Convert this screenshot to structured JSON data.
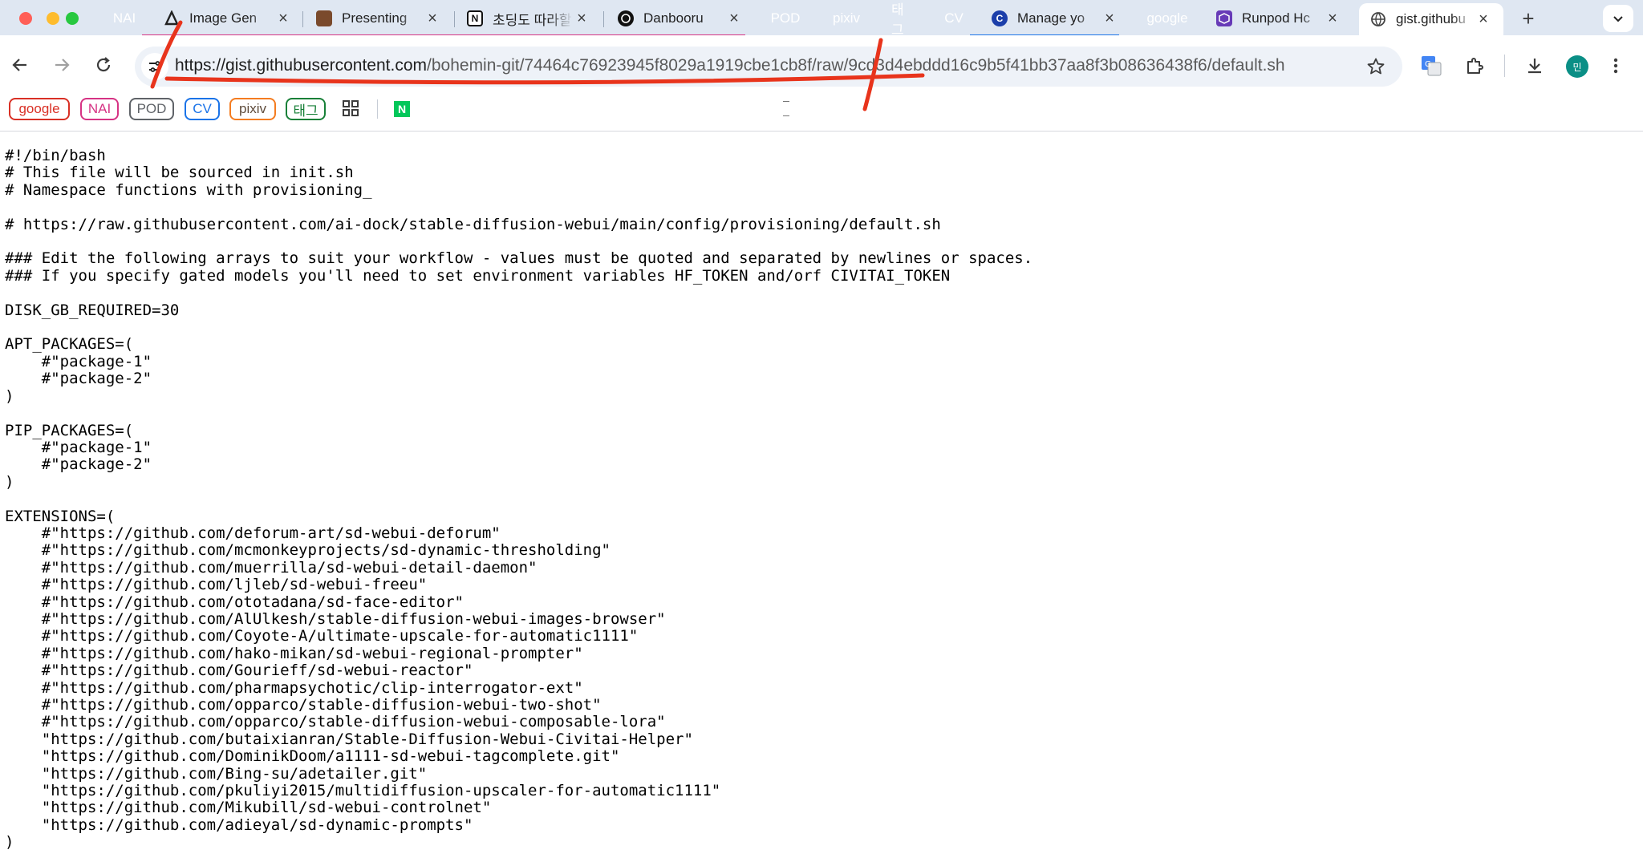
{
  "window": {
    "controls": [
      "close",
      "minimize",
      "zoom"
    ]
  },
  "tabs": [
    {
      "kind": "chip",
      "label": "NAI",
      "color": "#d63384"
    },
    {
      "kind": "tab",
      "title": "Image Gen",
      "icon": "novelai-icon"
    },
    {
      "kind": "tab",
      "title": "Presenting",
      "icon": "book-icon"
    },
    {
      "kind": "tab",
      "title": "초딩도 따라할",
      "icon": "notion-icon"
    },
    {
      "kind": "tab",
      "title": "Danbooru",
      "icon": "openai-icon"
    },
    {
      "kind": "chip",
      "label": "POD",
      "color": "#5f6368"
    },
    {
      "kind": "chip",
      "label": "pixiv",
      "color": "#f47c20"
    },
    {
      "kind": "chip",
      "label": "태그",
      "color": "#188038"
    },
    {
      "kind": "chip",
      "label": "CV",
      "color": "#1a73e8"
    },
    {
      "kind": "tab",
      "title": "Manage yo",
      "icon": "civitai-icon"
    },
    {
      "kind": "chip",
      "label": "google",
      "color": "#d93025"
    },
    {
      "kind": "tab",
      "title": "Runpod Hc",
      "icon": "runpod-icon"
    },
    {
      "kind": "tab",
      "title": "gist.githubu",
      "icon": "globe-icon",
      "active": true
    }
  ],
  "toolbar": {
    "url_host": "https://gist.githubusercontent.com",
    "url_path": "/bohemin-git/74464c76923945f8029a1919cbe1cb8f/raw/9cd3d4ebddd16c9b5f41bb37aa8f3b08636438f6/default.sh",
    "profile_initial": "민"
  },
  "bookmarks": [
    {
      "label": "google",
      "color": "#d93025"
    },
    {
      "label": "NAI",
      "color": "#d63384"
    },
    {
      "label": "POD",
      "color": "#5f6368"
    },
    {
      "label": "CV",
      "color": "#1a73e8"
    },
    {
      "label": "pixiv",
      "color": "#f47c20"
    },
    {
      "label": "태그",
      "color": "#188038"
    }
  ],
  "file": {
    "lines": [
      "#!/bin/bash",
      "# This file will be sourced in init.sh",
      "# Namespace functions with provisioning_",
      "",
      "# https://raw.githubusercontent.com/ai-dock/stable-diffusion-webui/main/config/provisioning/default.sh",
      "",
      "### Edit the following arrays to suit your workflow - values must be quoted and separated by newlines or spaces.",
      "### If you specify gated models you'll need to set environment variables HF_TOKEN and/orf CIVITAI_TOKEN",
      "",
      "DISK_GB_REQUIRED=30",
      "",
      "APT_PACKAGES=(",
      "    #\"package-1\"",
      "    #\"package-2\"",
      ")",
      "",
      "PIP_PACKAGES=(",
      "    #\"package-1\"",
      "    #\"package-2\"",
      ")",
      "",
      "EXTENSIONS=(",
      "    #\"https://github.com/deforum-art/sd-webui-deforum\"",
      "    #\"https://github.com/mcmonkeyprojects/sd-dynamic-thresholding\"",
      "    #\"https://github.com/muerrilla/sd-webui-detail-daemon\"",
      "    #\"https://github.com/ljleb/sd-webui-freeu\"",
      "    #\"https://github.com/ototadana/sd-face-editor\"",
      "    #\"https://github.com/AlUlkesh/stable-diffusion-webui-images-browser\"",
      "    #\"https://github.com/Coyote-A/ultimate-upscale-for-automatic1111\"",
      "    #\"https://github.com/hako-mikan/sd-webui-regional-prompter\"",
      "    #\"https://github.com/Gourieff/sd-webui-reactor\"",
      "    #\"https://github.com/pharmapsychotic/clip-interrogator-ext\"",
      "    #\"https://github.com/opparco/stable-diffusion-webui-two-shot\"",
      "    #\"https://github.com/opparco/stable-diffusion-webui-composable-lora\"",
      "    \"https://github.com/butaixianran/Stable-Diffusion-Webui-Civitai-Helper\"",
      "    \"https://github.com/DominikDoom/a1111-sd-webui-tagcomplete.git\"",
      "    \"https://github.com/Bing-su/adetailer.git\"",
      "    \"https://github.com/pkuliyi2015/multidiffusion-upscaler-for-automatic1111\"",
      "    \"https://github.com/Mikubill/sd-webui-controlnet\"",
      "    \"https://github.com/adieyal/sd-dynamic-prompts\"",
      ")"
    ]
  }
}
